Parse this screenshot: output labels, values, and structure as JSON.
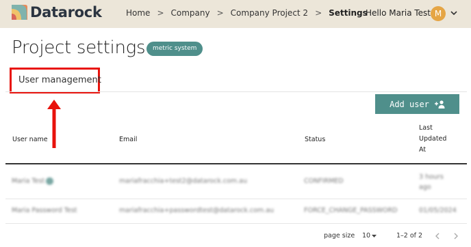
{
  "header": {
    "logo_text": "Datarock",
    "breadcrumbs": [
      "Home",
      "Company",
      "Company Project 2",
      "Settings"
    ],
    "greeting": "Hello Maria Test",
    "avatar_initial": "M"
  },
  "page": {
    "title": "Project settings",
    "badge": "metric system"
  },
  "tabs": {
    "active": "User management"
  },
  "actions": {
    "add_user": "Add user"
  },
  "table": {
    "columns": [
      "User name",
      "Email",
      "Status",
      "Last Updated At"
    ],
    "rows": [
      {
        "name": "Maria Test",
        "email": "mariafracchia+test2@datarock.com.au",
        "status": "CONFIRMED",
        "updated": "3 hours ago"
      },
      {
        "name": "Maria Password Test",
        "email": "mariafracchia+passwordtest@datarock.com.au",
        "status": "FORCE_CHANGE_PASSWORD",
        "updated": "01/05/2024"
      }
    ]
  },
  "pagination": {
    "page_size_label": "page size",
    "page_size": "10",
    "range": "1–2 of 2"
  },
  "colors": {
    "accent": "#4f8f8b",
    "highlight": "#e8120c",
    "topbar": "#ece6d9"
  }
}
